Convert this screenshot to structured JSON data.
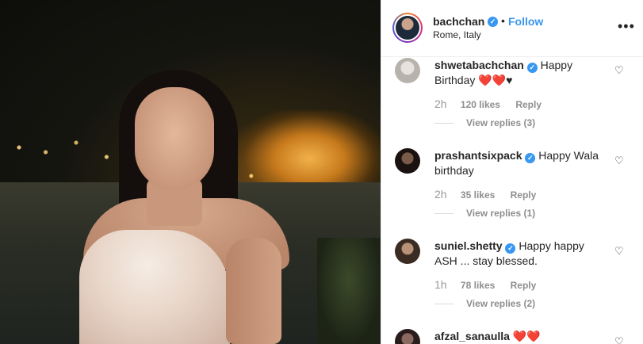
{
  "header": {
    "username": "bachchan",
    "verified_glyph": "✓",
    "separator": "•",
    "follow_label": "Follow",
    "location": "Rome, Italy",
    "more_icon": "more-options-icon"
  },
  "comments": [
    {
      "username": "shwetabachchan",
      "verified": true,
      "text": "Happy Birthday ❤️❤️♥",
      "time": "2h",
      "likes": "120 likes",
      "reply_label": "Reply",
      "view_replies": "View replies (3)",
      "avatar_color": "#d8d4d0"
    },
    {
      "username": "prashantsixpack",
      "verified": true,
      "text": "Happy Wala birthday",
      "time": "2h",
      "likes": "35 likes",
      "reply_label": "Reply",
      "view_replies": "View replies (1)",
      "avatar_color": "#2a1d18"
    },
    {
      "username": "suniel.shetty",
      "verified": true,
      "text": "Happy happy ASH ... stay blessed.",
      "time": "1h",
      "likes": "78 likes",
      "reply_label": "Reply",
      "view_replies": "View replies (2)",
      "avatar_color": "#4a3b30"
    },
    {
      "username": "afzal_sanaulla",
      "verified": false,
      "text": "❤️❤️",
      "avatar_color": "#3a2a2a"
    }
  ],
  "colors": {
    "accent": "#3897f0",
    "text": "#262626",
    "muted": "#8e8e8e"
  }
}
